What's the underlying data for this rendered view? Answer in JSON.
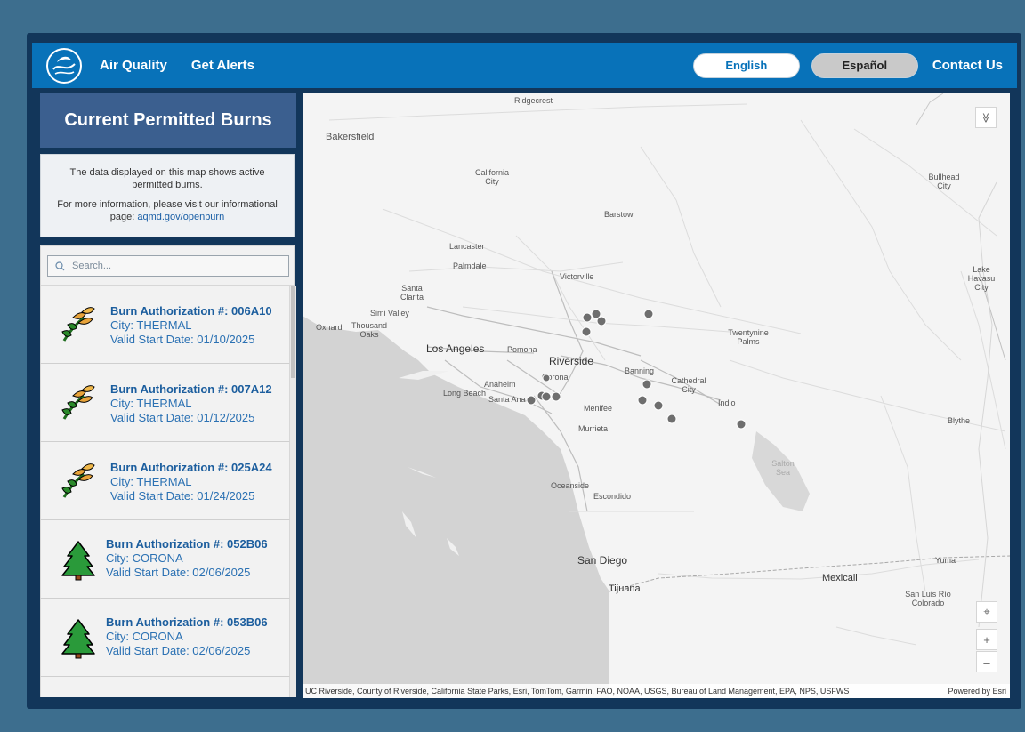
{
  "nav": {
    "air_quality": "Air Quality",
    "get_alerts": "Get Alerts",
    "english": "English",
    "espanol": "Español",
    "contact": "Contact Us"
  },
  "panel": {
    "title": "Current Permitted Burns",
    "info_line1": "The data displayed on this map shows active permitted burns.",
    "info_line2": "For more information, please visit our informational page:",
    "info_link": "aqmd.gov/openburn",
    "search_placeholder": "Search..."
  },
  "burns": [
    {
      "id": "Burn Authorization #: 006A10",
      "city": "City: THERMAL",
      "date": "Valid Start Date: 01/10/2025",
      "icon": "wheat-icon"
    },
    {
      "id": "Burn Authorization #: 007A12",
      "city": "City: THERMAL",
      "date": "Valid Start Date: 01/12/2025",
      "icon": "wheat-icon"
    },
    {
      "id": "Burn Authorization #: 025A24",
      "city": "City: THERMAL",
      "date": "Valid Start Date: 01/24/2025",
      "icon": "wheat-icon"
    },
    {
      "id": "Burn Authorization #: 052B06",
      "city": "City: CORONA",
      "date": "Valid Start Date: 02/06/2025",
      "icon": "tree-icon"
    },
    {
      "id": "Burn Authorization #: 053B06",
      "city": "City: CORONA",
      "date": "Valid Start Date: 02/06/2025",
      "icon": "tree-icon"
    }
  ],
  "map": {
    "places": {
      "ridgecrest": "Ridgecrest",
      "bakersfield": "Bakersfield",
      "california_city": "California City",
      "barstow": "Barstow",
      "bullhead_city": "Bullhead City",
      "lancaster": "Lancaster",
      "palmdale": "Palmdale",
      "victorville": "Victorville",
      "lake_havasu_city": "Lake Havasu City",
      "santa_clarita": "Santa Clarita",
      "simi_valley": "Simi Valley",
      "oxnard": "Oxnard",
      "thousand_oaks": "Thousand Oaks",
      "los_angeles": "Los Angeles",
      "pomona": "Pomona",
      "riverside": "Riverside",
      "twentynine_palms": "Twentynine Palms",
      "banning": "Banning",
      "cathedral_city": "Cathedral City",
      "corona": "Corona",
      "anaheim": "Anaheim",
      "long_beach": "Long Beach",
      "santa_ana": "Santa Ana",
      "indio": "Indio",
      "menifee": "Menifee",
      "murrieta": "Murrieta",
      "blythe": "Blythe",
      "salton_sea": "Salton Sea",
      "oceanside": "Oceanside",
      "escondido": "Escondido",
      "san_diego": "San Diego",
      "yuma": "Yuma",
      "mexicali": "Mexicali",
      "tijuana": "Tijuana",
      "san_luis_rio_colorado": "San Luis Río Colorado"
    },
    "attribution": "UC Riverside, County of Riverside, California State Parks, Esri, TomTom, Garmin, FAO, NOAA, USGS, Bureau of Land Management, EPA, NPS, USFWS",
    "powered_by": "Powered by Esri",
    "controls": {
      "collapse_glyph": "≫",
      "locate_glyph": "⌖",
      "zoom_in": "+",
      "zoom_out": "–"
    }
  },
  "colors": {
    "topbar": "#0872b9",
    "panel_title": "#3b5f8f",
    "link": "#1c5e9e",
    "burn_marker": "#6e6e6e"
  }
}
